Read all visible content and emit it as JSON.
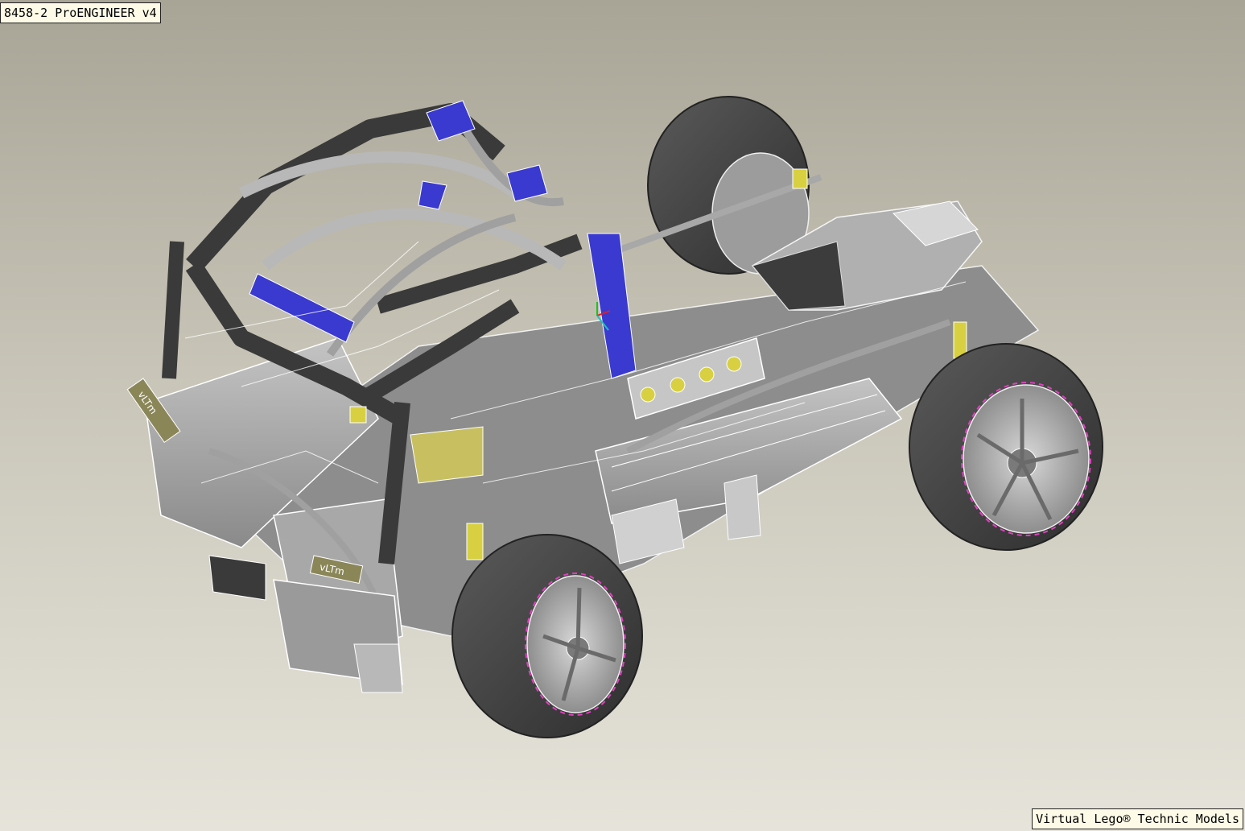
{
  "viewport": {
    "title_label": "8458-2 ProENGINEER v4",
    "credit_label": "Virtual Lego® Technic Models"
  },
  "model": {
    "decal_text": "vLTm",
    "colors": {
      "background_top": "#a8a496",
      "background_bottom": "#e6e4da",
      "beam_gray": "#9e9e9e",
      "beam_dark": "#3a3a3a",
      "accent_blue": "#3a3ad0",
      "accent_yellow": "#d8d040",
      "tire": "#4a4a4a",
      "rim_stripe": "#e040c0"
    }
  }
}
